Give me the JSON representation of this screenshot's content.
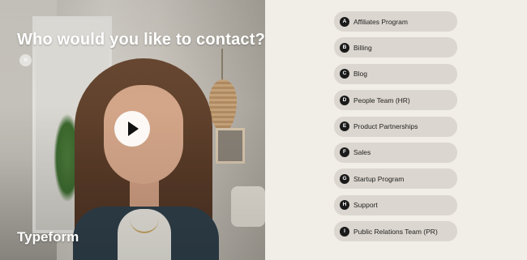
{
  "video": {
    "title": "Who would you like to contact?",
    "close_glyph": "×",
    "brand": "Typeform",
    "play_icon": "play-icon"
  },
  "options": [
    {
      "key": "A",
      "label": "Affiliates Program"
    },
    {
      "key": "B",
      "label": "Billing"
    },
    {
      "key": "C",
      "label": "Blog"
    },
    {
      "key": "D",
      "label": "People Team (HR)"
    },
    {
      "key": "E",
      "label": "Product Partnerships"
    },
    {
      "key": "F",
      "label": "Sales"
    },
    {
      "key": "G",
      "label": "Startup Program"
    },
    {
      "key": "H",
      "label": "Support"
    },
    {
      "key": "I",
      "label": "Public Relations Team (PR)"
    }
  ],
  "colors": {
    "right_background": "#f1eee8",
    "option_background": "#dbd6cf",
    "key_badge": "#1a1a1a"
  }
}
